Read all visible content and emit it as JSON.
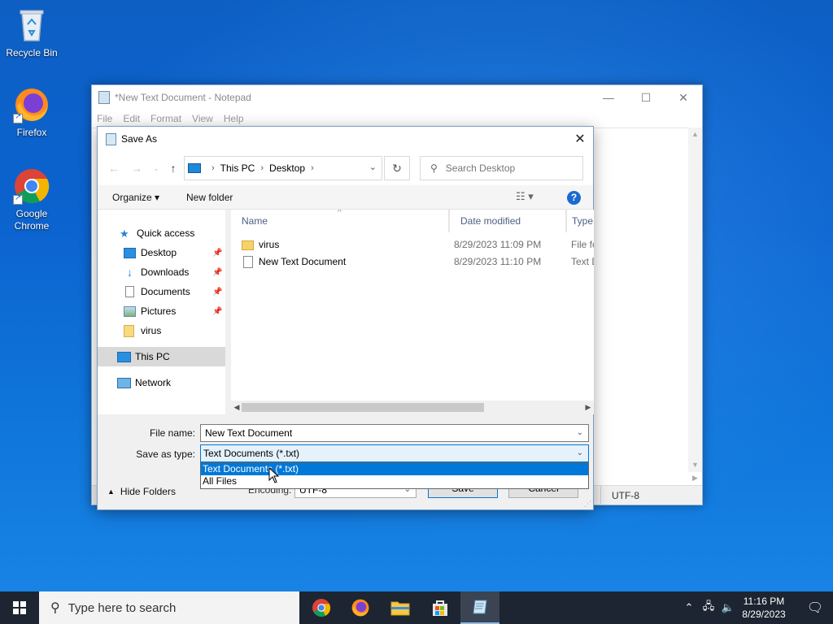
{
  "desktop": {
    "icons": [
      {
        "label": "Recycle Bin"
      },
      {
        "label": "Firefox"
      },
      {
        "label": "Google Chrome"
      }
    ]
  },
  "notepad": {
    "title": "*New Text Document - Notepad",
    "menu": [
      "File",
      "Edit",
      "Format",
      "View",
      "Help"
    ],
    "status_encoding": "UTF-8"
  },
  "dialog": {
    "title": "Save As",
    "address": {
      "root": "This PC",
      "folder": "Desktop"
    },
    "search_placeholder": "Search Desktop",
    "toolbar": {
      "organize": "Organize",
      "new_folder": "New folder"
    },
    "nav": [
      {
        "label": "Quick access"
      },
      {
        "label": "Desktop"
      },
      {
        "label": "Downloads"
      },
      {
        "label": "Documents"
      },
      {
        "label": "Pictures"
      },
      {
        "label": "virus"
      },
      {
        "label": "This PC"
      },
      {
        "label": "Network"
      }
    ],
    "columns": [
      "Name",
      "Date modified",
      "Type"
    ],
    "files": [
      {
        "name": "virus",
        "date": "8/29/2023 11:09 PM",
        "type": "File fo"
      },
      {
        "name": "New Text Document",
        "date": "8/29/2023 11:10 PM",
        "type": "Text D"
      }
    ],
    "file_name_label": "File name:",
    "file_name_value": "New Text Document",
    "save_type_label": "Save as type:",
    "save_type_value": "Text Documents (*.txt)",
    "save_type_options": [
      "Text Documents (*.txt)",
      "All Files"
    ],
    "encoding_label": "Encoding:",
    "encoding_value": "UTF-8",
    "save_button": "Save",
    "cancel_button": "Cancel",
    "hide_folders": "Hide Folders"
  },
  "taskbar": {
    "search_placeholder": "Type here to search",
    "time": "11:16 PM",
    "date": "8/29/2023"
  }
}
